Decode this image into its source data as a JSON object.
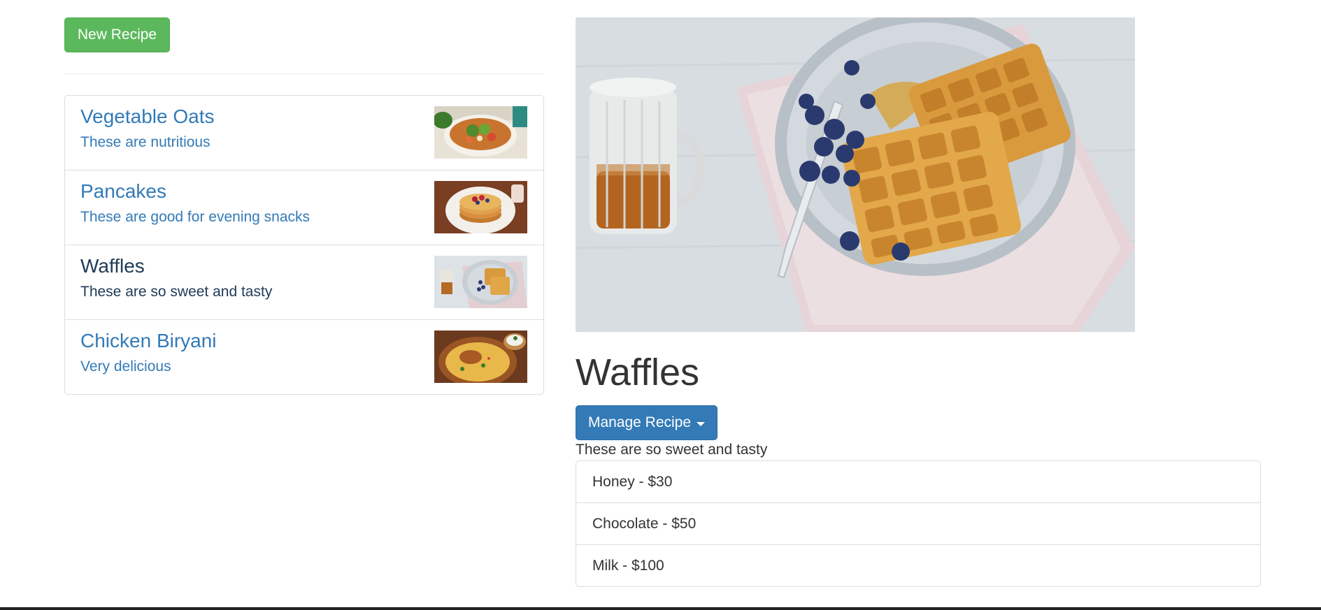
{
  "toolbar": {
    "new_recipe_label": "New Recipe"
  },
  "recipes": [
    {
      "title": "Vegetable Oats",
      "description": "These are nutritious",
      "image": "vegetable-oats-bowl",
      "active": false
    },
    {
      "title": "Pancakes",
      "description": "These are good for evening snacks",
      "image": "pancake-stack",
      "active": false
    },
    {
      "title": "Waffles",
      "description": "These are so sweet and tasty",
      "image": "waffles-plate",
      "active": true
    },
    {
      "title": "Chicken Biryani",
      "description": "Very delicious",
      "image": "biryani-bowl",
      "active": false
    }
  ],
  "detail": {
    "image": "waffles-with-blueberries-and-syrup",
    "title": "Waffles",
    "manage_label": "Manage Recipe",
    "description": "These are so sweet and tasty",
    "ingredients": [
      "Honey - $30",
      "Chocolate - $50",
      "Milk - $100"
    ]
  },
  "colors": {
    "success": "#5cb85c",
    "primary": "#337ab7",
    "link": "#337ab7",
    "active_link": "#1f3a56"
  }
}
